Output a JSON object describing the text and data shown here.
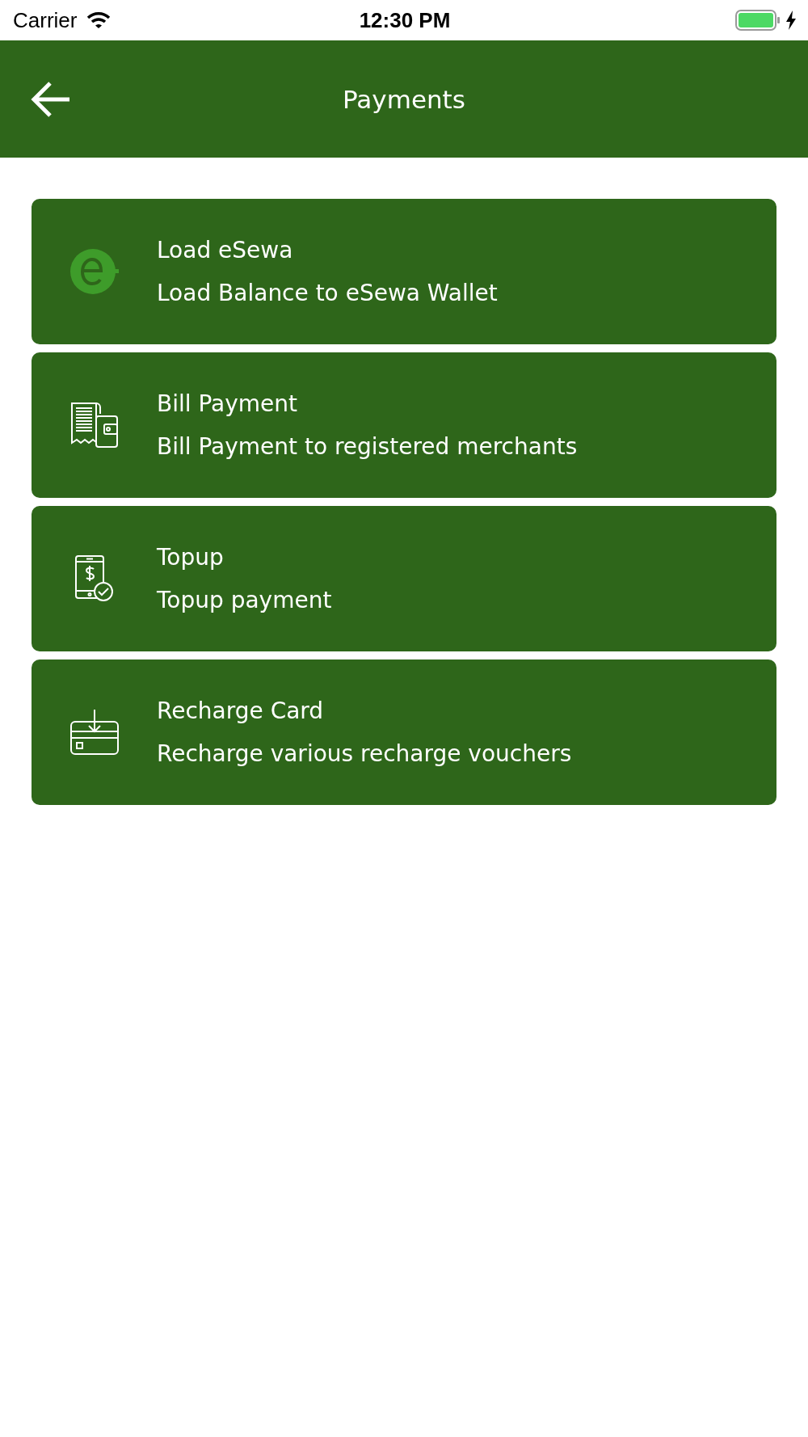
{
  "status_bar": {
    "carrier": "Carrier",
    "time": "12:30 PM"
  },
  "header": {
    "title": "Payments"
  },
  "items": [
    {
      "kind": "esewa",
      "title": "Load eSewa",
      "subtitle": "Load Balance to eSewa Wallet"
    },
    {
      "kind": "bill",
      "title": "Bill Payment",
      "subtitle": "Bill Payment to registered merchants"
    },
    {
      "kind": "topup",
      "title": "Topup",
      "subtitle": "Topup payment"
    },
    {
      "kind": "card",
      "title": "Recharge Card",
      "subtitle": "Recharge various recharge vouchers"
    }
  ]
}
